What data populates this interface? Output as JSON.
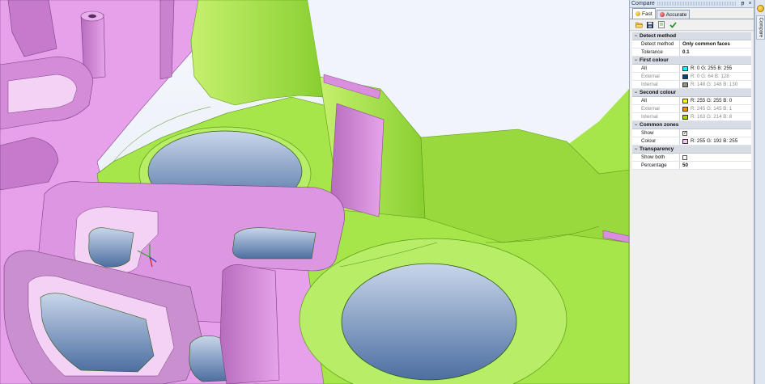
{
  "panel": {
    "title": "Compare",
    "pin_glyph": "ᵽ",
    "close_glyph": "×",
    "tabs": [
      {
        "label": "Fast",
        "active": true,
        "icon": "fast-compare-icon"
      },
      {
        "label": "Accurate",
        "active": false,
        "icon": "accurate-compare-icon"
      }
    ],
    "toolbar": {
      "open_icon": "folder-open-icon",
      "save_icon": "save-icon",
      "report_icon": "report-icon",
      "apply_icon": "checkmark-icon"
    },
    "categories": {
      "detect": {
        "label": "Detect method",
        "method_key": "Detect method",
        "method_val": "Only common faces",
        "tol_key": "Tolerance",
        "tol_val": "0.1"
      },
      "first": {
        "label": "First colour",
        "all_key": "All",
        "all_val": "R: 0 G: 255 B: 255",
        "all_color": "#00ffff",
        "ext_key": "External",
        "ext_val": "R: 0 G: 64 B: 128",
        "ext_color": "#004080",
        "int_key": "Internal",
        "int_val": "R: 148 G: 148 B: 130",
        "int_color": "#949482"
      },
      "second": {
        "label": "Second colour",
        "all_key": "All",
        "all_val": "R: 255 G: 255 B: 0",
        "all_color": "#ffff00",
        "ext_key": "External",
        "ext_val": "R: 245 G: 145 B: 1",
        "ext_color": "#f59101",
        "int_key": "Internal",
        "int_val": "R: 163 G: 214 B: 8",
        "int_color": "#a3d608"
      },
      "common": {
        "label": "Common zones",
        "show_key": "Show",
        "show_val": "✓",
        "colour_key": "Colour",
        "colour_val": "R: 255 G: 192 B: 255",
        "colour_color": "#ffc0ff"
      },
      "transparency": {
        "label": "Transparency",
        "showboth_key": "Show both",
        "showboth_val": "",
        "pct_key": "Percentage",
        "pct_val": "50"
      }
    }
  },
  "sidestrip": {
    "tab_label": "Compare",
    "icon": "compare-sun-icon"
  },
  "colors": {
    "part_pink": "#e29ae6",
    "part_pink_dark": "#a35aa8",
    "part_green": "#a6e64a",
    "part_green_dark": "#6fae20",
    "sky_top": "#eef3fb",
    "hole_blue": "#5d7fb0"
  }
}
